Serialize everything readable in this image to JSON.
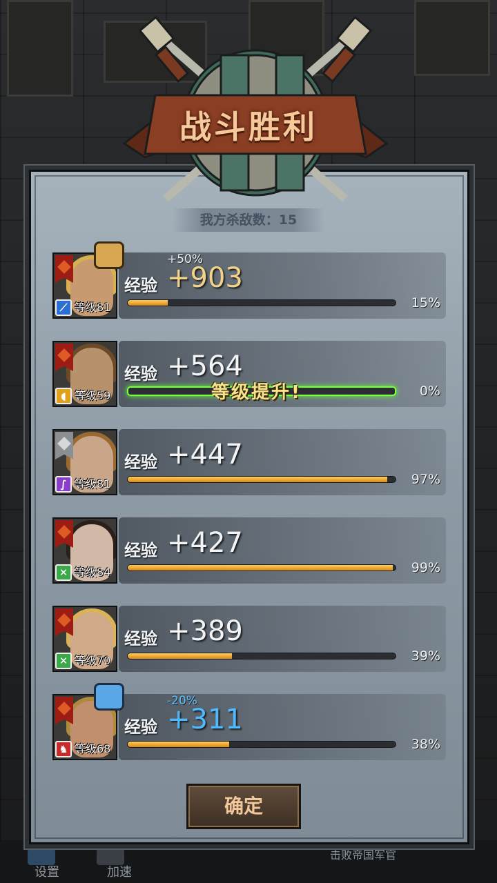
{
  "title": "战斗胜利",
  "kills": "我方杀敌数：15",
  "exp_label": "经验",
  "levelup_text": "等级提升!",
  "confirm_label": "确定",
  "bottom": {
    "settings": "设置",
    "speed": "加速",
    "defeat": "击败帝国军官"
  },
  "colors": {
    "gold": "#f3d28a",
    "blue": "#4fb9ff",
    "bar": "#f0a828",
    "levelup": "#7dff4a"
  },
  "heroes": [
    {
      "level": "等级81",
      "exp": "+903",
      "bonus": "+50%",
      "progress": 15,
      "pct": "15%",
      "class_icon": "sword-icon",
      "thumb": "thumbs-up-icon"
    },
    {
      "level": "等级59",
      "exp": "+564",
      "progress": 0,
      "pct": "0%",
      "class_icon": "shield-icon",
      "levelup": true
    },
    {
      "level": "等级81",
      "exp": "+447",
      "progress": 97,
      "pct": "97%",
      "class_icon": "staff-icon"
    },
    {
      "level": "等级84",
      "exp": "+427",
      "progress": 99,
      "pct": "99%",
      "class_icon": "crossed-axes-icon"
    },
    {
      "level": "等级70",
      "exp": "+389",
      "progress": 39,
      "pct": "39%",
      "class_icon": "crossed-axes-icon"
    },
    {
      "level": "等级68",
      "exp": "+311",
      "bonus": "-20%",
      "progress": 38,
      "pct": "38%",
      "class_icon": "beast-icon",
      "thumb": "thumbs-down-icon"
    }
  ]
}
